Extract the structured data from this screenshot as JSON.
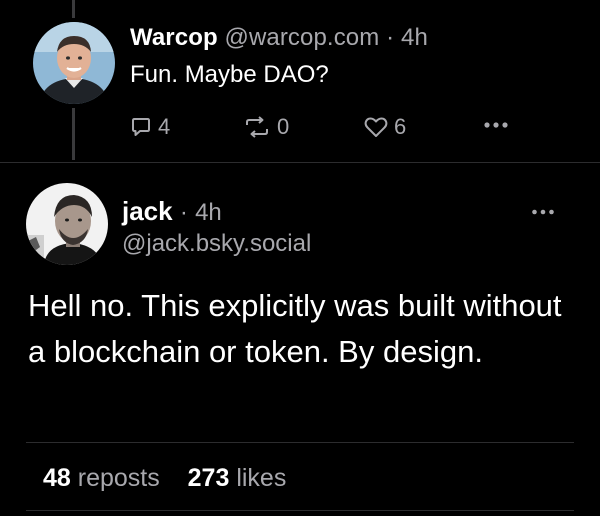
{
  "reply": {
    "display_name": "Warcop",
    "handle": "@warcop.com",
    "separator": "·",
    "time": "4h",
    "text": "Fun.  Maybe DAO?",
    "reply_count": "4",
    "repost_count": "0",
    "like_count": "6",
    "avatar_icon": "person-photo-avatar"
  },
  "post": {
    "display_name": "jack",
    "separator": "·",
    "time": "4h",
    "handle": "@jack.bsky.social",
    "text": "Hell no. This explicitly was built without a blockchain or token. By design.",
    "reposts_count": "48",
    "reposts_label": "reposts",
    "likes_count": "273",
    "likes_label": "likes",
    "avatar_icon": "person-photo-avatar"
  },
  "colors": {
    "background": "#000000",
    "text": "#ffffff",
    "muted": "#a8a8ad",
    "divider": "#2c2c2e",
    "thread_line": "#3a3a3c"
  },
  "icons": [
    "reply-icon",
    "repost-icon",
    "like-icon",
    "more-horizontal-icon"
  ]
}
